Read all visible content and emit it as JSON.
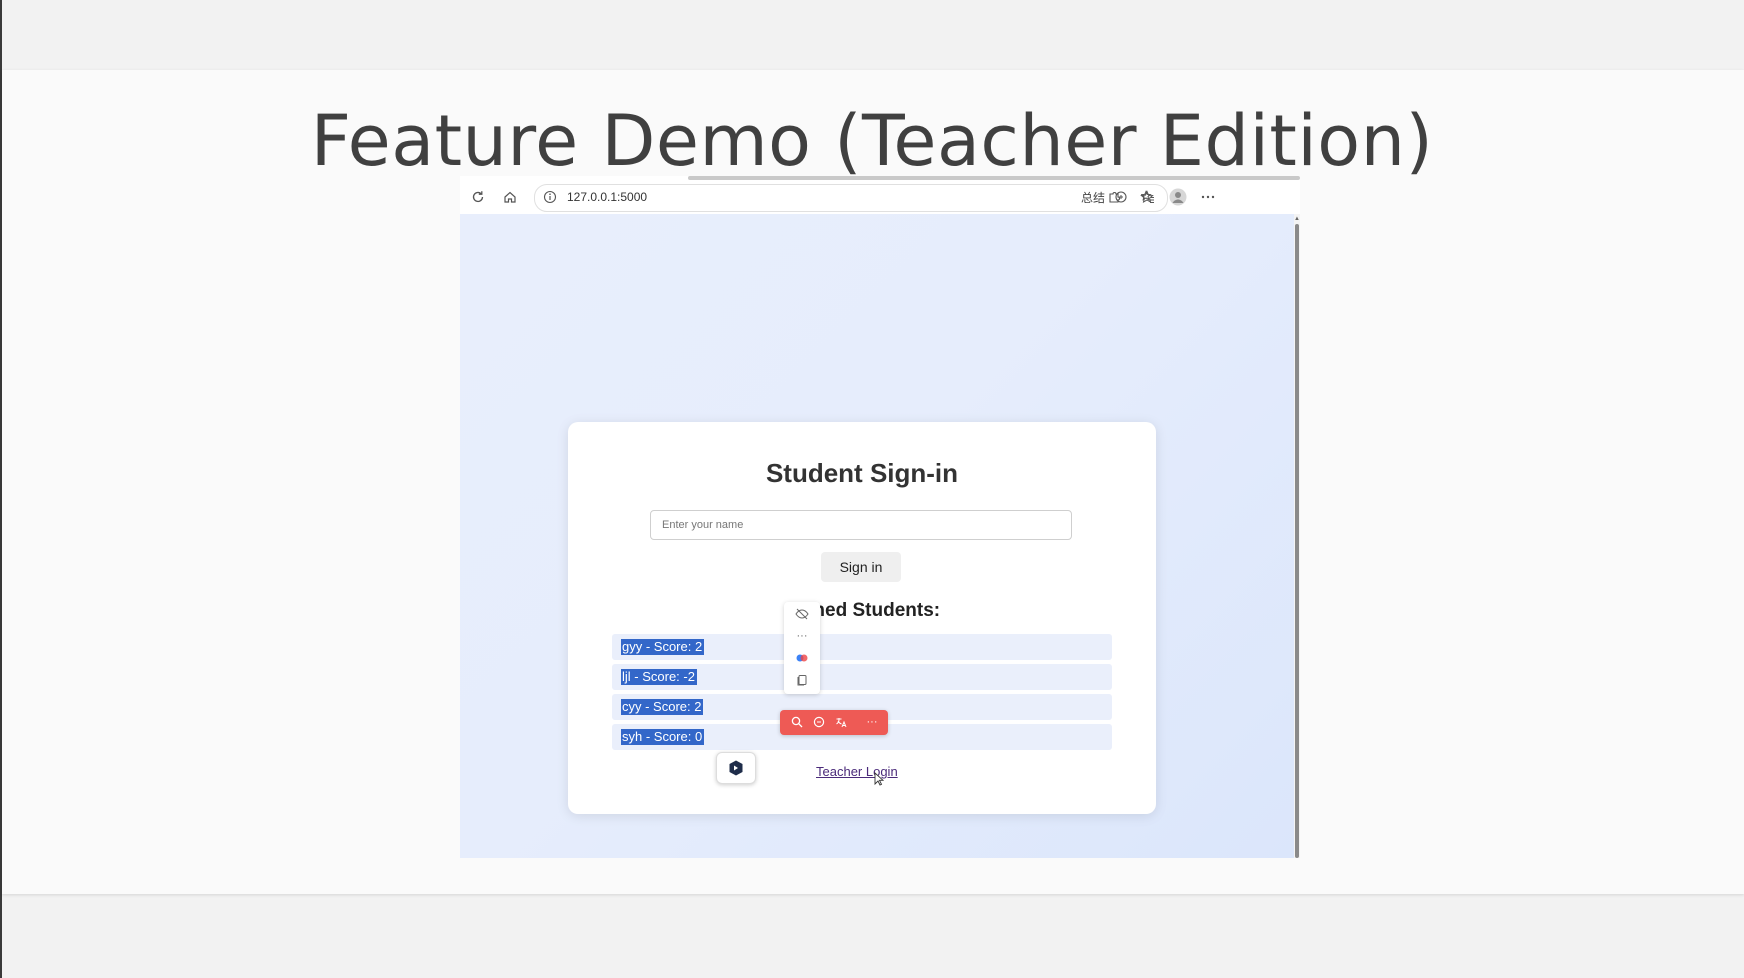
{
  "slide": {
    "title": "Feature Demo (Teacher Edition)"
  },
  "browser": {
    "url": "127.0.0.1:5000",
    "summary_label": "总结",
    "icons": [
      "refresh-icon",
      "home-icon",
      "info-icon",
      "read-aloud-icon",
      "favorite-star-icon",
      "extensions-icon",
      "favorites-list-icon",
      "profile-icon",
      "more-icon"
    ]
  },
  "page": {
    "title": "Student Sign-in",
    "name_placeholder": "Enter your name",
    "sign_in_label": "Sign in",
    "signed_title": "Signed Students:",
    "students": [
      {
        "text": "gyy - Score: 2"
      },
      {
        "text": "ljl - Score: -2"
      },
      {
        "text": "cyy - Score: 2"
      },
      {
        "text": "syh - Score: 0"
      }
    ],
    "teacher_login_label": "Teacher Login"
  },
  "context_menu": {
    "items": [
      "hide-icon",
      "more-dots-icon",
      "copilot-color-icon",
      "copy-icon"
    ]
  },
  "float_toolbar": {
    "items": [
      "search-icon",
      "chat-icon",
      "translate-icon",
      "more-icon"
    ],
    "color": "#ee5a55"
  },
  "colors": {
    "selection": "#3367c9",
    "link": "#4a2a7a",
    "row_bg": "#eaeffb"
  }
}
